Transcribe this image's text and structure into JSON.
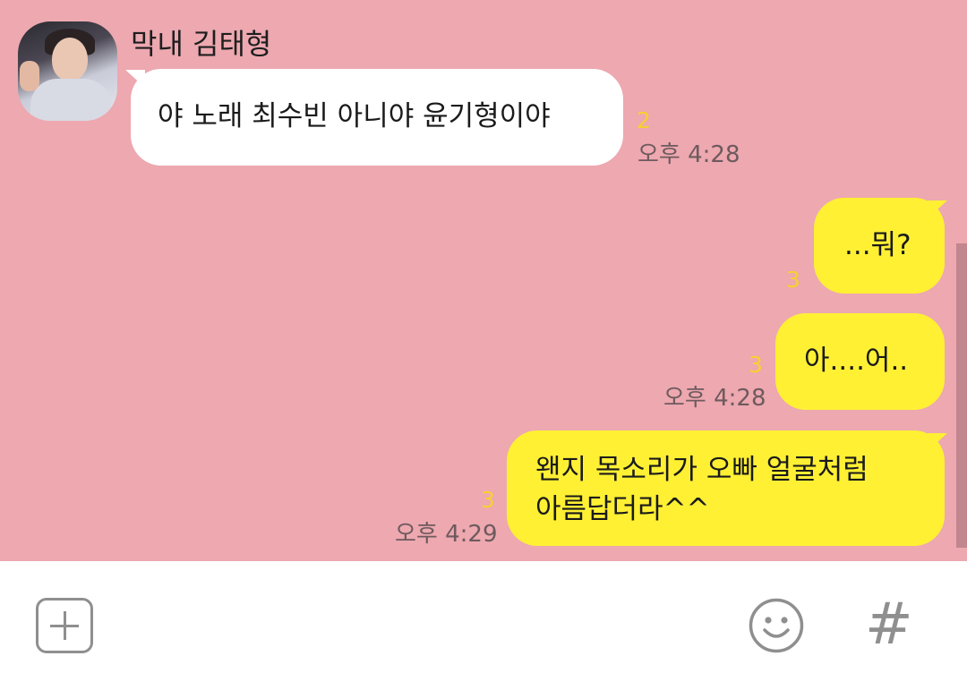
{
  "chat": {
    "sender_name": "막내 김태형",
    "messages": [
      {
        "direction": "in",
        "text": "야 노래 최수빈 아니야 윤기형이야",
        "unread": "2",
        "time": "오후 4:28"
      },
      {
        "direction": "out",
        "text": "...뭐?",
        "unread": "3",
        "time": ""
      },
      {
        "direction": "out",
        "text": "아....어..",
        "unread": "3",
        "time": "오후 4:28"
      },
      {
        "direction": "out",
        "text_line1": "왠지 목소리가 오빠 얼굴처럼",
        "text_line2": "아름답더라^^",
        "unread": "3",
        "time": "오후 4:29"
      }
    ]
  },
  "input_bar": {
    "plus_icon": "plus-icon",
    "emoji_icon": "smiley-icon",
    "hash_label": "#"
  },
  "colors": {
    "background": "#eda8b0",
    "incoming_bubble": "#ffffff",
    "outgoing_bubble": "#fff034",
    "unread_count": "#f6d12f",
    "timestamp": "#6e5a5e"
  }
}
